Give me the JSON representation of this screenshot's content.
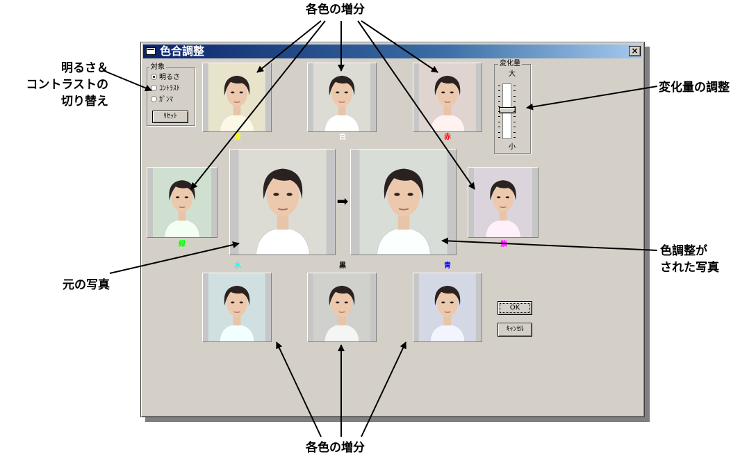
{
  "annotations": {
    "top_increments": "各色の増分",
    "bottom_increments": "各色の増分",
    "brightness_line1": "明るさ＆",
    "brightness_line2": "コントラストの",
    "brightness_line3": "切り替え",
    "amount_adjust": "変化量の調整",
    "original_photo": "元の写真",
    "adjusted_line1": "色調整が",
    "adjusted_line2": "された写真"
  },
  "dialog": {
    "title": "色合調整",
    "close_label": "×",
    "target_group": {
      "title": "対象",
      "options": [
        "明るさ",
        "ｺﾝﾄﾗｽﾄ",
        "ｶﾞﾝﾏ"
      ],
      "selected": "明るさ"
    },
    "reset_label": "ﾘｾｯﾄ",
    "amount_group": {
      "title": "変化量",
      "max_label": "大",
      "min_label": "小"
    },
    "ok_label": "OK",
    "cancel_label": "ｷｬﾝｾﾙ",
    "arrow_glyph": "➡",
    "swatches": {
      "yellow": {
        "label": "黄",
        "color": "#ffff00"
      },
      "white": {
        "label": "白",
        "color": "#ffffff"
      },
      "red": {
        "label": "赤",
        "color": "#ff0000"
      },
      "green": {
        "label": "緑",
        "color": "#00ff00"
      },
      "purple": {
        "label": "紫",
        "color": "#ff00ff"
      },
      "cyan": {
        "label": "水",
        "color": "#00ffff"
      },
      "black": {
        "label": "黒",
        "color": "#000000"
      },
      "blue": {
        "label": "青",
        "color": "#0000ff"
      }
    }
  }
}
